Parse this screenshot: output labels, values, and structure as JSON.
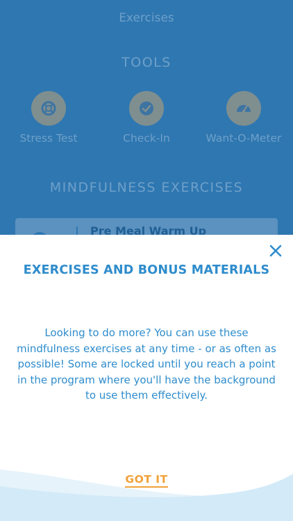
{
  "header": {
    "title": "Exercises"
  },
  "tools": {
    "section_title": "TOOLS",
    "items": [
      {
        "label": "Stress Test",
        "icon": "lifebuoy-icon"
      },
      {
        "label": "Check-In",
        "icon": "checkmark-icon"
      },
      {
        "label": "Want-O-Meter",
        "icon": "gauge-icon"
      }
    ]
  },
  "mindfulness": {
    "section_title": "MINDFULNESS EXERCISES",
    "first_item": "Pre Meal Warm Up"
  },
  "modal": {
    "title": "EXERCISES AND BONUS MATERIALS",
    "body": "Looking to do more? You can use these mindfulness exercises at any time - or as often as possible!  Some are locked until you reach a point in the program where you'll have the background to use them effectively.",
    "button_label": "GOT IT"
  },
  "colors": {
    "background_blue": "#2f77b1",
    "modal_text_blue": "#2e8ccc",
    "accent_orange": "#f0a238"
  }
}
